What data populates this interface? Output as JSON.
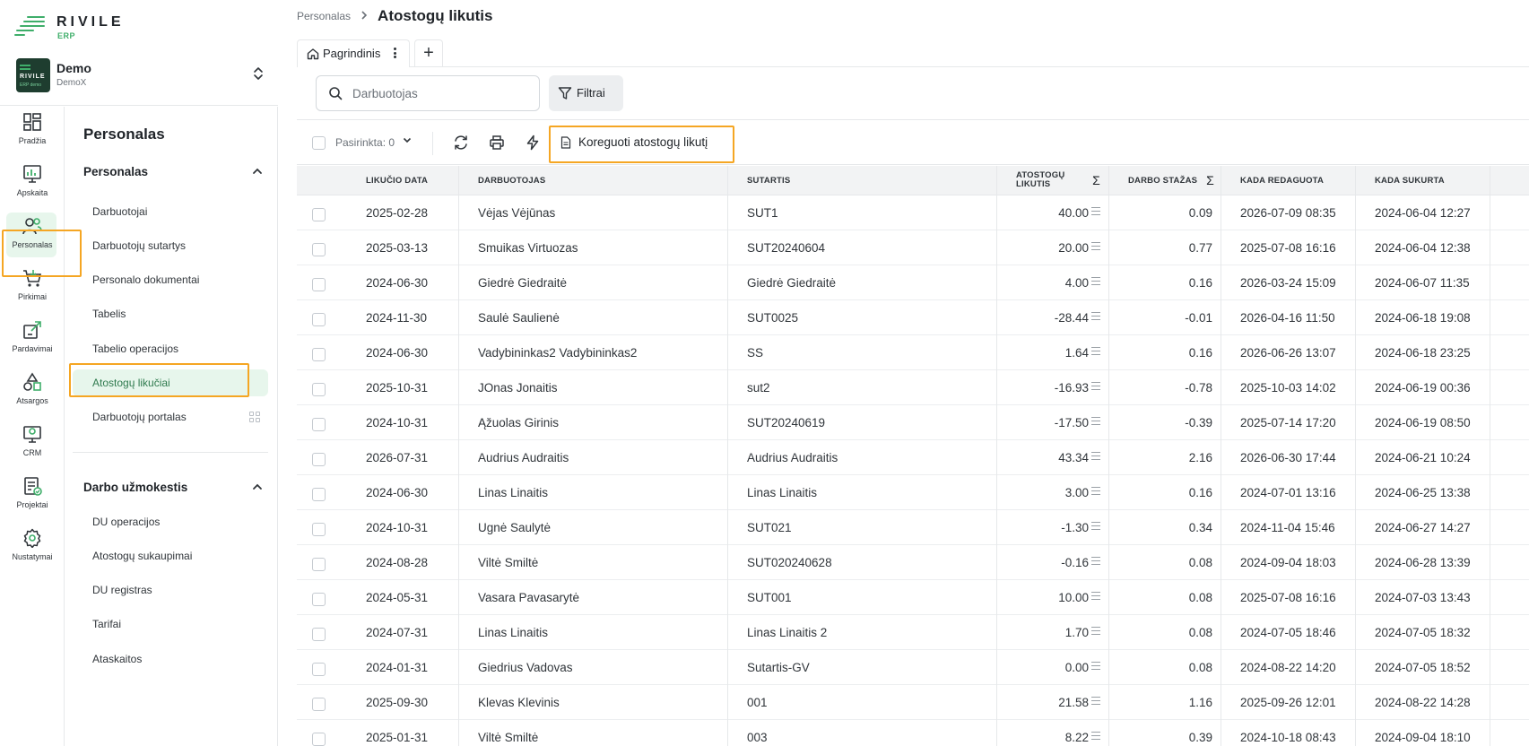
{
  "logo": {
    "text": "RIVILE",
    "sub": "ERP"
  },
  "company": {
    "name": "Demo",
    "code": "DemoX",
    "avatar_text": "RIVILE",
    "avatar_sub": "ERP demo"
  },
  "rail": [
    {
      "label": "Pradžia",
      "icon": "dashboard-icon"
    },
    {
      "label": "Apskaita",
      "icon": "chart-icon"
    },
    {
      "label": "Personalas",
      "icon": "people-icon"
    },
    {
      "label": "Pirkimai",
      "icon": "cart-icon"
    },
    {
      "label": "Pardavimai",
      "icon": "sales-icon"
    },
    {
      "label": "Atsargos",
      "icon": "shapes-icon"
    },
    {
      "label": "CRM",
      "icon": "crm-icon"
    },
    {
      "label": "Projektai",
      "icon": "projects-icon"
    },
    {
      "label": "Nustatymai",
      "icon": "gear-icon"
    }
  ],
  "subnav": {
    "title": "Personalas",
    "group1": {
      "label": "Personalas",
      "items": [
        "Darbuotojai",
        "Darbuotojų sutartys",
        "Personalo dokumentai",
        "Tabelis",
        "Tabelio operacijos",
        "Atostogų likučiai",
        "Darbuotojų portalas"
      ]
    },
    "group2": {
      "label": "Darbo užmokestis",
      "items": [
        "DU operacijos",
        "Atostogų sukaupimai",
        "DU registras",
        "Tarifai",
        "Ataskaitos"
      ]
    }
  },
  "breadcrumb": {
    "parent": "Personalas",
    "current": "Atostogų likutis"
  },
  "tab": {
    "label": "Pagrindinis",
    "add": "+"
  },
  "search": {
    "placeholder": "Darbuotojas",
    "value": ""
  },
  "filters_label": "Filtrai",
  "toolbar": {
    "selected_label": "Pasirinkta: 0",
    "action_label": "Koreguoti atostogų likutį"
  },
  "columns": {
    "date": "Likučio data",
    "employee": "Darbuotojas",
    "contract": "Sutartis",
    "balance": "Atostogų likutis",
    "tenure": "Darbo stažas",
    "edited": "Kada redaguota",
    "created": "Kada sukurta"
  },
  "rows": [
    {
      "date": "2025-02-28",
      "employee": "Vėjas Vėjūnas",
      "contract": "SUT1",
      "balance": "40.00",
      "tenure": "0.09",
      "edited": "2026-07-09 08:35",
      "created": "2024-06-04 12:27"
    },
    {
      "date": "2025-03-13",
      "employee": "Smuikas Virtuozas",
      "contract": "SUT20240604",
      "balance": "20.00",
      "tenure": "0.77",
      "edited": "2025-07-08 16:16",
      "created": "2024-06-04 12:38"
    },
    {
      "date": "2024-06-30",
      "employee": "Giedrė Giedraitė",
      "contract": "Giedrė Giedraitė",
      "balance": "4.00",
      "tenure": "0.16",
      "edited": "2026-03-24 15:09",
      "created": "2024-06-07 11:35"
    },
    {
      "date": "2024-11-30",
      "employee": "Saulė Saulienė",
      "contract": "SUT0025",
      "balance": "-28.44",
      "tenure": "-0.01",
      "edited": "2026-04-16 11:50",
      "created": "2024-06-18 19:08"
    },
    {
      "date": "2024-06-30",
      "employee": "Vadybininkas2 Vadybininkas2",
      "contract": "SS",
      "balance": "1.64",
      "tenure": "0.16",
      "edited": "2026-06-26 13:07",
      "created": "2024-06-18 23:25"
    },
    {
      "date": "2025-10-31",
      "employee": "JOnas Jonaitis",
      "contract": "sut2",
      "balance": "-16.93",
      "tenure": "-0.78",
      "edited": "2025-10-03 14:02",
      "created": "2024-06-19 00:36"
    },
    {
      "date": "2024-10-31",
      "employee": "Ąžuolas Girinis",
      "contract": "SUT20240619",
      "balance": "-17.50",
      "tenure": "-0.39",
      "edited": "2025-07-14 17:20",
      "created": "2024-06-19 08:50"
    },
    {
      "date": "2026-07-31",
      "employee": "Audrius Audraitis",
      "contract": "Audrius Audraitis",
      "balance": "43.34",
      "tenure": "2.16",
      "edited": "2026-06-30 17:44",
      "created": "2024-06-21 10:24"
    },
    {
      "date": "2024-06-30",
      "employee": "Linas Linaitis",
      "contract": "Linas Linaitis",
      "balance": "3.00",
      "tenure": "0.16",
      "edited": "2024-07-01 13:16",
      "created": "2024-06-25 13:38"
    },
    {
      "date": "2024-10-31",
      "employee": "Ugnė Saulytė",
      "contract": "SUT021",
      "balance": "-1.30",
      "tenure": "0.34",
      "edited": "2024-11-04 15:46",
      "created": "2024-06-27 14:27"
    },
    {
      "date": "2024-08-28",
      "employee": "Viltė Smiltė",
      "contract": "SUT020240628",
      "balance": "-0.16",
      "tenure": "0.08",
      "edited": "2024-09-04 18:03",
      "created": "2024-06-28 13:39"
    },
    {
      "date": "2024-05-31",
      "employee": "Vasara Pavasarytė",
      "contract": "SUT001",
      "balance": "10.00",
      "tenure": "0.08",
      "edited": "2025-07-08 16:16",
      "created": "2024-07-03 13:43"
    },
    {
      "date": "2024-07-31",
      "employee": "Linas Linaitis",
      "contract": "Linas Linaitis 2",
      "balance": "1.70",
      "tenure": "0.08",
      "edited": "2024-07-05 18:46",
      "created": "2024-07-05 18:32"
    },
    {
      "date": "2024-01-31",
      "employee": "Giedrius Vadovas",
      "contract": "Sutartis-GV",
      "balance": "0.00",
      "tenure": "0.08",
      "edited": "2024-08-22 14:20",
      "created": "2024-07-05 18:52"
    },
    {
      "date": "2025-09-30",
      "employee": "Klevas Klevinis",
      "contract": "001",
      "balance": "21.58",
      "tenure": "1.16",
      "edited": "2025-09-26 12:01",
      "created": "2024-08-22 14:28"
    },
    {
      "date": "2025-01-31",
      "employee": "Viltė Smiltė",
      "contract": "003",
      "balance": "8.22",
      "tenure": "0.39",
      "edited": "2024-10-18 08:43",
      "created": "2024-09-04 18:10"
    }
  ],
  "colors": {
    "accent": "#3fae6a",
    "highlight": "#f5a623",
    "active_bg": "#e7f6ec"
  }
}
